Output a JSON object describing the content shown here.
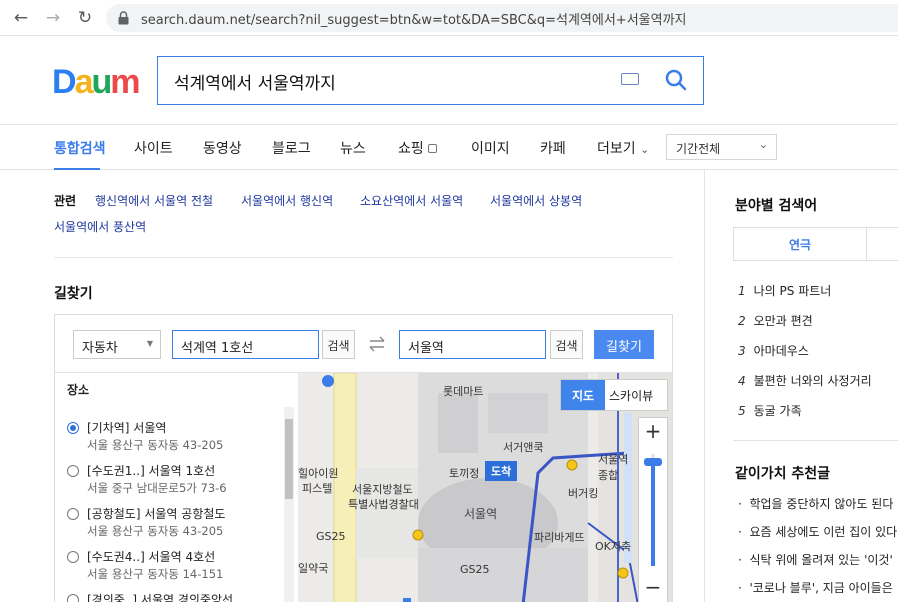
{
  "browser": {
    "url": "search.daum.net/search?nil_suggest=btn&w=tot&DA=SBC&q=석계역에서+서울역까지"
  },
  "header": {
    "logo_text": "Daum",
    "query": "석계역에서 서울역까지"
  },
  "tabs": [
    "통합검색",
    "사이트",
    "동영상",
    "블로그",
    "뉴스",
    "쇼핑",
    "이미지",
    "카페",
    "더보기"
  ],
  "period_select": "기간전체",
  "related": {
    "label": "관련",
    "items": [
      "행신역에서 서울역 전철",
      "서울역에서 행신역",
      "소요산역에서 서울역",
      "서울역에서 상봉역",
      "서울역에서 풍산역"
    ]
  },
  "directions": {
    "title": "길찾기",
    "mode": "자동차",
    "from": "석계역 1호선",
    "to": "서울역",
    "search_label": "검색",
    "find_label": "길찾기",
    "places_label": "장소",
    "places": [
      {
        "name": "[기차역] 서울역",
        "addr": "서울 용산구 동자동 43-205",
        "selected": true
      },
      {
        "name": "[수도권1..] 서울역 1호선",
        "addr": "서울 중구 남대문로5가 73-6",
        "selected": false
      },
      {
        "name": "[공항철도] 서울역 공항철도",
        "addr": "서울 용산구 동자동 43-205",
        "selected": false
      },
      {
        "name": "[수도권4..] 서울역 4호선",
        "addr": "서울 용산구 동자동 14-151",
        "selected": false
      },
      {
        "name": "[경의중..] 서울역 경의중앙선",
        "addr": "",
        "selected": false
      }
    ]
  },
  "map": {
    "mode_map": "지도",
    "mode_sky": "스카이뷰",
    "labels": [
      "롯데마트",
      "서거앤쿡",
      "토끼정",
      "도착",
      "서울지방철도",
      "특별사법경찰대",
      "서울역",
      "버거킹",
      "파리바게뜨",
      "OK저축",
      "서울역 종합",
      "GS25",
      "GS25",
      "힐아이원",
      "피스텔",
      "일약국"
    ],
    "zoom_in": "+",
    "zoom_out": "−"
  },
  "sidebar": {
    "title": "분야별 검색어",
    "tab_active": "연극",
    "ranks": [
      {
        "n": "1",
        "t": "나의 PS 파트너"
      },
      {
        "n": "2",
        "t": "오만과 편견"
      },
      {
        "n": "3",
        "t": "아마데우스"
      },
      {
        "n": "4",
        "t": "불편한 너와의 사정거리"
      },
      {
        "n": "5",
        "t": "동굴 가족"
      }
    ],
    "rec_title": "같이가치 추천글",
    "recs": [
      "학업을 중단하지 않아도 된다",
      "요즘 세상에도 이런 집이 있다",
      "식탁 위에 올려져 있는 '이것'",
      "'코로나 블루', 지금 아이들은"
    ]
  }
}
